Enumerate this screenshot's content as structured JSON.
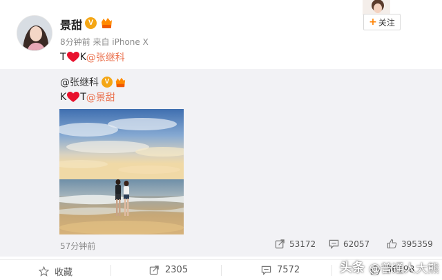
{
  "post": {
    "author": "景甜",
    "meta": "8分钟前 来自 iPhone X",
    "text_before_heart": "T",
    "text_after_heart": "K",
    "mention": "@张继科",
    "follow_label": "关注",
    "follow_plus": "+"
  },
  "repost": {
    "author": "@张继科",
    "text_before_heart": "K",
    "text_after_heart": "T",
    "mention": "@景甜",
    "time": "57分钟前",
    "stats": {
      "reposts": "53172",
      "comments": "62057",
      "likes": "395359"
    }
  },
  "actions": {
    "favorite": "收藏",
    "reposts": "2305",
    "comments": "7572",
    "likes": "36198"
  },
  "watermark": {
    "platform": "头条",
    "account": "@普通人大熊"
  },
  "colors": {
    "mention": "#eb7350",
    "verified_badge": "#f4a614",
    "repost_bg": "#f2f2f5",
    "heart": "#e8112d"
  }
}
